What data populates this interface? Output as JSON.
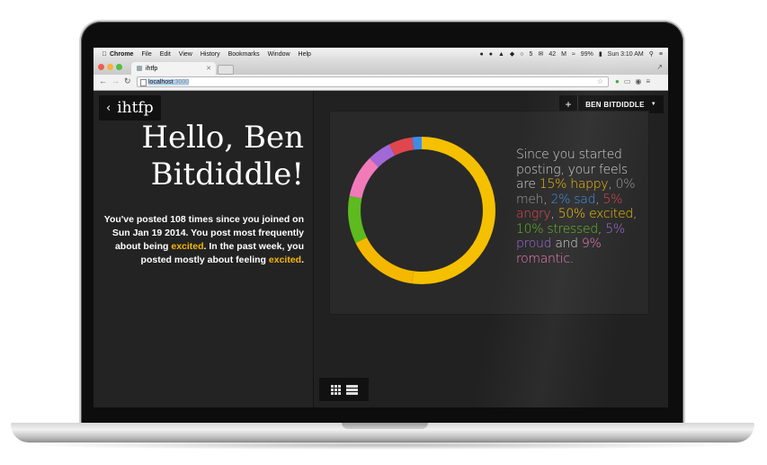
{
  "menubar": {
    "app_name": "Chrome",
    "items": [
      "File",
      "Edit",
      "View",
      "History",
      "Bookmarks",
      "Window",
      "Help"
    ],
    "status": {
      "badge": "5",
      "mail_count": "42",
      "battery": "99%",
      "clock": "Sun 3:10 AM"
    }
  },
  "browser": {
    "tab_title": "ihtfp",
    "url_host": "localhost",
    "url_port": ":3000"
  },
  "app": {
    "back_label": "ihtfp",
    "greeting": "Hello, Ben Bitdiddle!",
    "summary": {
      "line1": "You've posted 108 times since you joined on Sun Jan 19 2014. You post most frequently about being ",
      "word1": "excited",
      "line2": ". In the past week, you posted mostly about feeling ",
      "word2": "excited",
      "line3": "."
    },
    "add_label": "+",
    "user_name": "BEN BITDIDDLE",
    "feels_intro": "Since you started posting, your feels are ",
    "feels": [
      {
        "text": "15% happy",
        "color": "#f5b800",
        "value": 15
      },
      {
        "text": "0% meh",
        "color": "#9a9a9a",
        "value": 0
      },
      {
        "text": "2% sad",
        "color": "#3d8de8",
        "value": 2
      },
      {
        "text": "5% angry",
        "color": "#e0464e",
        "value": 5
      },
      {
        "text": "50% excited",
        "color": "#f5c000",
        "value": 50
      },
      {
        "text": "10% stressed",
        "color": "#5dbb1f",
        "value": 10
      },
      {
        "text": "5% proud",
        "color": "#a268d8",
        "value": 5
      },
      {
        "text": "9% romantic",
        "color": "#f07bb8",
        "value": 9
      }
    ]
  },
  "colors": {
    "highlight": "#f5b800",
    "background": "#212121",
    "accent_happy": "#f5a800"
  }
}
